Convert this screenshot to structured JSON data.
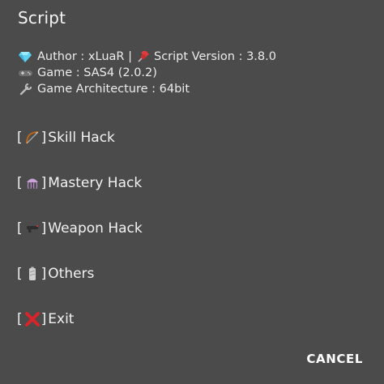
{
  "dialog": {
    "title": "Script"
  },
  "info": {
    "author_label": "Author : xLuaR |",
    "version_label": "Script Version : 3.8.0",
    "game_label": "Game : SAS4 (2.0.2)",
    "arch_label": "Game Architecture : 64bit",
    "icons": {
      "author": "gem-icon",
      "version": "pushpin-icon",
      "game": "gamepad-icon",
      "arch": "wrench-icon"
    }
  },
  "menu": {
    "items": [
      {
        "open": "[",
        "icon": "bow-arrow-icon",
        "close": "]",
        "label": "Skill Hack"
      },
      {
        "open": "[",
        "icon": "jellyfish-icon",
        "close": "]",
        "label": "Mastery Hack"
      },
      {
        "open": "[",
        "icon": "gun-icon",
        "close": "]",
        "label": "Weapon Hack"
      },
      {
        "open": "[",
        "icon": "battery-icon",
        "close": "]",
        "label": "Others"
      },
      {
        "open": "[",
        "icon": "cross-mark-icon",
        "close": "]",
        "label": "Exit"
      }
    ]
  },
  "actions": {
    "cancel_label": "CANCEL"
  },
  "colors": {
    "background": "#4b4b4b",
    "text": "#f2f2f2",
    "gem": "#5fd0f0",
    "pin": "#e23b3b",
    "cross": "#d8242a"
  }
}
